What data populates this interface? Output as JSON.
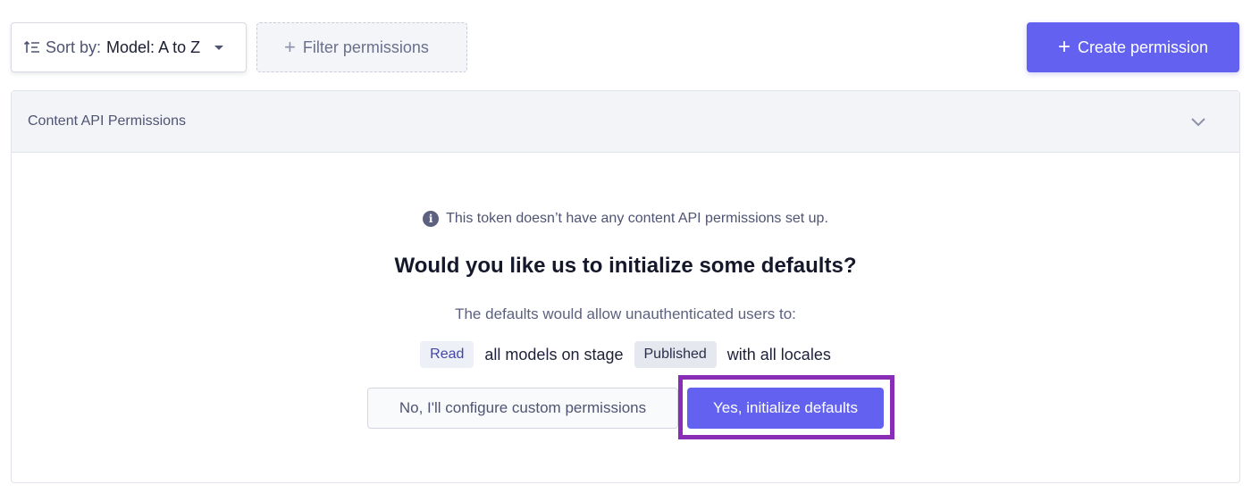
{
  "toolbar": {
    "sort_label": "Sort by:",
    "sort_value": "Model: A to Z",
    "sort_icon": "sort-ascending-icon",
    "filter_label": "Filter permissions",
    "create_label": "Create permission"
  },
  "panel": {
    "title": "Content API Permissions",
    "info_text": "This token doesn’t have any content API permissions set up.",
    "question": "Would you like us to initialize some defaults?",
    "defaults_desc": "The defaults would allow unauthenticated users to:",
    "defaults": {
      "action": "Read",
      "text_1": "all models on stage",
      "stage": "Published",
      "text_2": "with all locales"
    },
    "decline_label": "No, I'll configure custom permissions",
    "accept_label": "Yes, initialize defaults"
  },
  "colors": {
    "accent": "#6261f0",
    "highlight": "#8a2db6"
  }
}
